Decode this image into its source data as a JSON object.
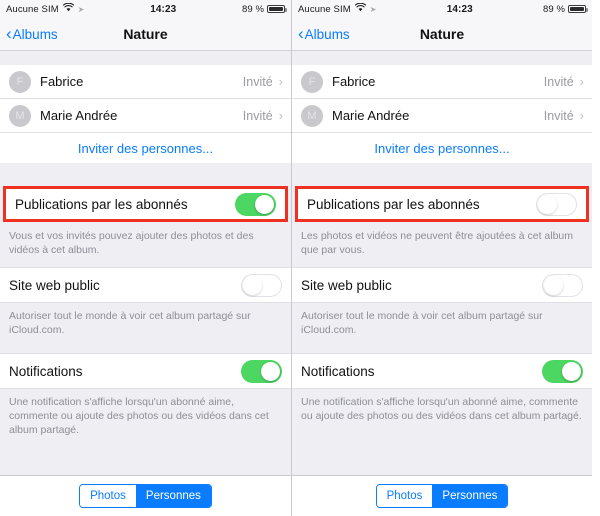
{
  "statusbar": {
    "carrier": "Aucune SIM",
    "wifi_icon": "wifi-icon",
    "location_icon": "location-icon",
    "time": "14:23",
    "battery_percent": "89 %",
    "battery_icon": "battery-icon"
  },
  "navbar": {
    "back_label": "Albums",
    "back_icon": "chevron-left-icon",
    "title": "Nature"
  },
  "people": {
    "items": [
      {
        "initial": "F",
        "name": "Fabrice",
        "role": "Invité",
        "chevron": "chevron-right-icon"
      },
      {
        "initial": "M",
        "name": "Marie Andrée",
        "role": "Invité",
        "chevron": "chevron-right-icon"
      }
    ],
    "invite_label": "Inviter des personnes..."
  },
  "settings": {
    "subscriber_posts": {
      "label": "Publications par les abonnés",
      "left_state": "on",
      "right_state": "off",
      "left_description": "Vous et vos invités pouvez ajouter des photos et des vidéos à cet album.",
      "right_description": "Les photos et vidéos ne peuvent être ajoutées à cet album que par vous."
    },
    "public_website": {
      "label": "Site web public",
      "state": "off",
      "description": "Autoriser tout le monde à voir cet album partagé sur iCloud.com."
    },
    "notifications": {
      "label": "Notifications",
      "state": "on",
      "description": "Une notification s'affiche lorsqu'un abonné aime, commente ou ajoute des photos ou des vidéos dans cet album partagé."
    }
  },
  "bottombar": {
    "photos_label": "Photos",
    "people_label": "Personnes",
    "selected": "Personnes"
  },
  "colors": {
    "accent_blue": "#0a7cff",
    "toggle_on_green": "#4cd662",
    "highlight_red": "#ef3124",
    "group_background": "#eeeef3"
  }
}
